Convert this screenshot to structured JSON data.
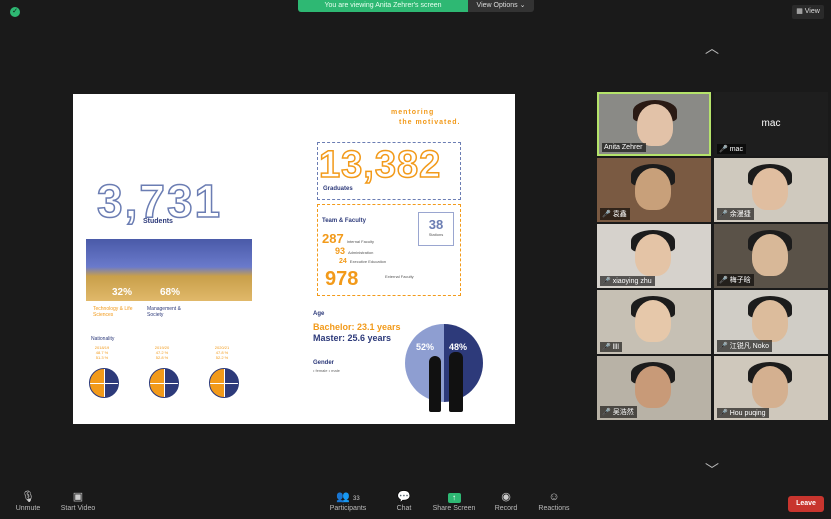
{
  "banner": {
    "message": "You are viewing Anita Zehrer's screen",
    "view_options": "View Options ⌄"
  },
  "top_right": {
    "view_label": "View"
  },
  "slide": {
    "motto_line1": "mentoring",
    "motto_line2": "the motivated.",
    "students_number": "3,731",
    "students_label": "Students",
    "tech_pct": "32%",
    "mgmt_pct": "68%",
    "tech_caption": "Technology & Life Sciences",
    "mgmt_caption": "Management & Society",
    "nationality_label": "Nationality",
    "years": [
      {
        "year": "2018/19",
        "a": "48.7 %",
        "b": "51.3 %"
      },
      {
        "year": "2019/20",
        "a": "47.2 %",
        "b": "52.8 %"
      },
      {
        "year": "2020/21",
        "a": "47.8 %",
        "b": "52.2 %"
      }
    ],
    "graduates_number": "13,382",
    "graduates_label": "Graduates",
    "team_faculty_label": "Team & Faculty",
    "internal_number": "287",
    "internal_label": "Internal Faculty",
    "admin_number": "93",
    "admin_label": "Administration",
    "exec_number": "24",
    "exec_label": "Executive Education",
    "stations_number": "38",
    "stations_label": "Stations",
    "external_number": "978",
    "external_label": "External Faculty",
    "age_label": "Age",
    "bachelor": "Bachelor: 23.1 years",
    "master": "Master: 25.6 years",
    "gender_label": "Gender",
    "gender_key": "• female   • male",
    "female_pct": "52%",
    "male_pct": "48%"
  },
  "participants": [
    {
      "name": "Anita Zehrer",
      "mic": ""
    },
    {
      "name": "mac",
      "mic": "🎤"
    },
    {
      "name": "袁鑫",
      "mic": "🎤"
    },
    {
      "name": "余漫捷",
      "mic": "🎤"
    },
    {
      "name": "xiaoying zhu",
      "mic": "🎤"
    },
    {
      "name": "梅子晗",
      "mic": "🎤"
    },
    {
      "name": "llll",
      "mic": "🎤"
    },
    {
      "name": "江锐凡 Noko",
      "mic": "🎤"
    },
    {
      "name": "吴浩然",
      "mic": "🎤"
    },
    {
      "name": "Hou puqing",
      "mic": "🎤"
    }
  ],
  "mac_big_name": "mac",
  "toolbar": {
    "unmute": "Unmute",
    "start_video": "Start Video",
    "participants": "Participants",
    "participants_count": "33",
    "chat": "Chat",
    "share_screen": "Share Screen",
    "record": "Record",
    "reactions": "Reactions",
    "leave": "Leave"
  }
}
